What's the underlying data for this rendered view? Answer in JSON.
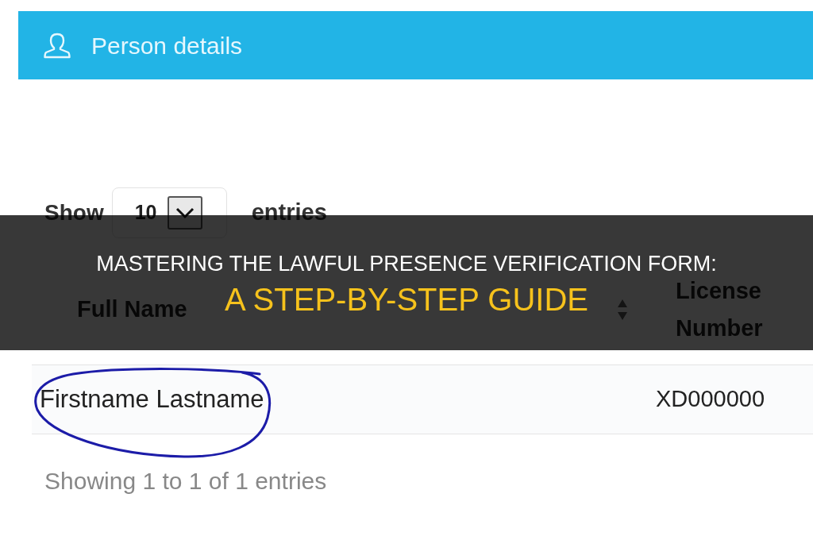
{
  "panel": {
    "title": "Person details"
  },
  "page_length": {
    "label_before": "Show",
    "value": "10",
    "label_after": "entries"
  },
  "table": {
    "columns": [
      {
        "label": "Full Name",
        "sortable": true
      },
      {
        "label": "License Number",
        "sortable": false
      }
    ],
    "rows": [
      {
        "cells": [
          "Firstname Lastname",
          "XD000000"
        ],
        "circled": true
      }
    ]
  },
  "info": "Showing 1 to 1 of 1 entries",
  "banner": {
    "title": "MASTERING THE LAWFUL PRESENCE VERIFICATION FORM:",
    "subtitle": "A STEP-BY-STEP GUIDE"
  }
}
